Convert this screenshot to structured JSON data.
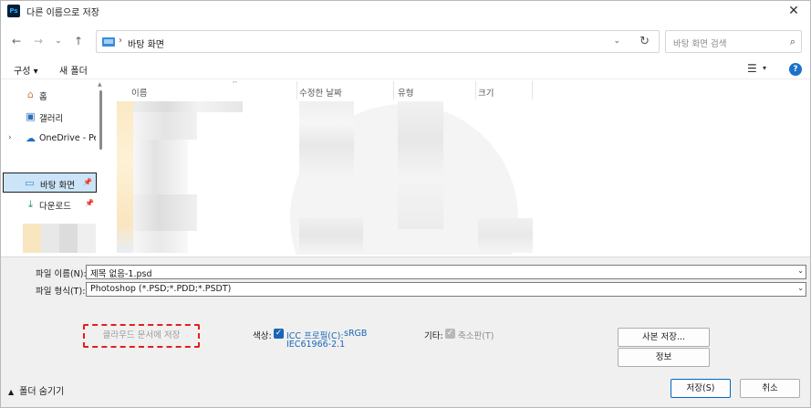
{
  "window": {
    "title": "다른 이름으로 저장",
    "app_icon": "Ps",
    "close": "✕"
  },
  "address": {
    "separator": "›",
    "path": "바탕 화면",
    "search_placeholder": "바탕 화면 검색"
  },
  "toolbar": {
    "organize": "구성 ▾",
    "new_folder": "새 폴더",
    "help": "?"
  },
  "nav": {
    "items": [
      {
        "label": "홈"
      },
      {
        "label": "갤러리"
      },
      {
        "label": "OneDrive - Pers"
      },
      {
        "label": "바탕 화면"
      },
      {
        "label": "다운로드"
      }
    ]
  },
  "columns": {
    "name": "이름",
    "modified": "수정한 날짜",
    "type": "유형",
    "size": "크기"
  },
  "form": {
    "filename_label": "파일 이름(N):",
    "filename_value": "제목 없음-1.psd",
    "filetype_label": "파일 형식(T):",
    "filetype_value": "Photoshop (*.PSD;*.PDD;*.PSDT)",
    "cloud_button": "클라우드 문서에 저장",
    "color_label": "색상:",
    "icc_label": "ICC 프로필(C):",
    "icc_value": "sRGB",
    "icc_value_line2": "IEC61966-2.1",
    "other_label": "기타:",
    "thumbnail_label": "축소판(T)",
    "save_copy": "사본 저장...",
    "info": "정보"
  },
  "footer": {
    "hide_folders": "폴더 숨기기",
    "save": "저장(S)",
    "cancel": "취소"
  },
  "colors": {
    "accent": "#0067c0",
    "link": "#1a66b5",
    "cloud_border": "#e02020",
    "selected_bg": "#cce4f7"
  }
}
